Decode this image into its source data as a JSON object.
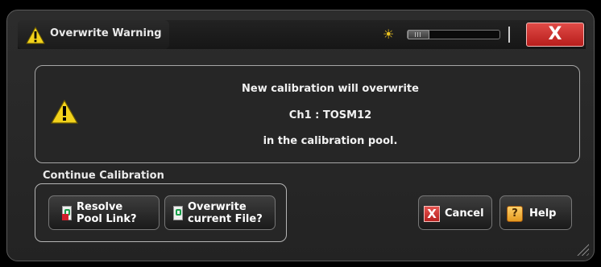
{
  "window": {
    "title": "Overwrite Warning",
    "title_icon": "warning-icon",
    "close_label": "X"
  },
  "controls": {
    "brightness_icon": "sun-icon",
    "brightness_slider": "brightness-slider"
  },
  "message": {
    "icon": "warning-icon",
    "line1": "New calibration will overwrite",
    "line2": "Ch1 : TOSM12",
    "line3": "in the calibration pool."
  },
  "continue_section": {
    "label": "Continue Calibration",
    "resolve_line1": "Resolve",
    "resolve_line2": "Pool Link?",
    "overwrite_line1": "Overwrite",
    "overwrite_line2": "current File?"
  },
  "buttons": {
    "cancel_label": "Cancel",
    "cancel_icon_glyph": "X",
    "help_label": "Help",
    "help_icon_glyph": "?"
  },
  "colors": {
    "accent_red": "#c8302c",
    "warning_yellow": "#f2d21b"
  }
}
